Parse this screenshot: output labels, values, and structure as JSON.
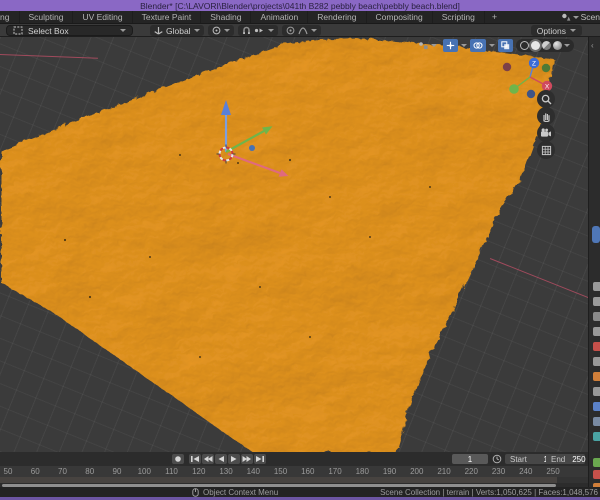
{
  "window": {
    "title": "Blender* [C:\\LAVORI\\Blender\\projects\\041th B282 pebbly beach\\pebbly beach.blend]"
  },
  "topbar": {
    "tabs": [
      "Modeling",
      "Sculpting",
      "UV Editing",
      "Texture Paint",
      "Shading",
      "Animation",
      "Rendering",
      "Compositing",
      "Scripting"
    ],
    "add_tab": "+",
    "scene_selector": "Scen"
  },
  "tool_settings": {
    "active_tool": "Select Box",
    "orientation": "Global",
    "options": "Options"
  },
  "viewport": {
    "nav_axis_labels": {
      "z": "Z",
      "x": "X"
    },
    "side_icons": [
      "zoom-icon",
      "pan-hand-icon",
      "camera-view-icon",
      "toggle-grid-icon"
    ],
    "header_icons": [
      "object-visibility-icon",
      "gizmo-toggle-icon",
      "overlays-toggle-icon",
      "xray-toggle-icon",
      "shading-wireframe-icon",
      "shading-solid-icon",
      "shading-material-icon",
      "shading-rendered-icon"
    ]
  },
  "timeline": {
    "playback": [
      "record",
      "jump-to-start",
      "previous-keyframe",
      "play-reverse",
      "play",
      "next-keyframe",
      "jump-to-end"
    ],
    "current_frame": "1",
    "start_label": "Start",
    "start_value": "1",
    "end_label": "End",
    "end_value": "250",
    "ticks": [
      "50",
      "60",
      "70",
      "80",
      "90",
      "100",
      "110",
      "120",
      "130",
      "140",
      "150",
      "160",
      "170",
      "180",
      "190",
      "200",
      "210",
      "220",
      "230",
      "240",
      "250"
    ]
  },
  "properties_sliver": {
    "icon_colors": [
      "#9a9a9a",
      "#9a9a9a",
      "#8a8a8a",
      "#999999",
      "#c5504a",
      "#999999",
      "#d07f3a",
      "#999999",
      "#5b82c9",
      "#7a8ba3",
      "#4aa3a3",
      "#6aa84f",
      "#c5504a",
      "#d07f3a"
    ]
  },
  "status_bar": {
    "left": "Object Context Menu",
    "right": "Scene Collection | terrain | Verts:1,050,625 | Faces:1,048,576"
  },
  "colors": {
    "titlebar": "#8a68c5",
    "taskbar": "#6c55a3",
    "accent_blue": "#4772b3",
    "terrain_orange": "#d4861a",
    "axis_red": "#b34d63",
    "viewport_bg": "#3b3b3b"
  }
}
